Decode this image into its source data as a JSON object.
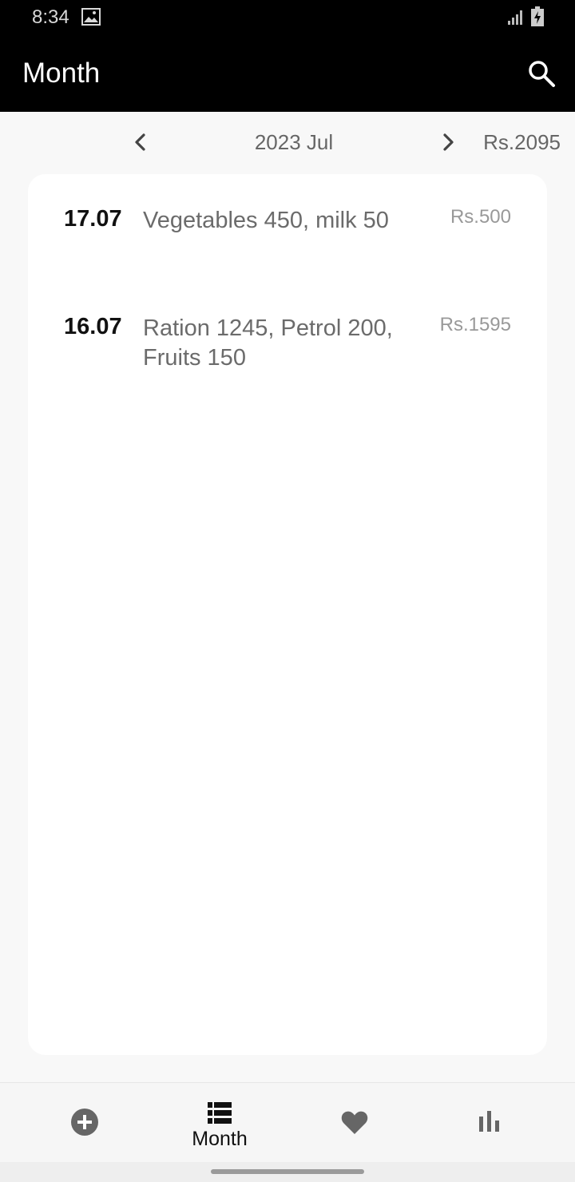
{
  "status_bar": {
    "time": "8:34"
  },
  "app_bar": {
    "title": "Month"
  },
  "month_nav": {
    "label": "2023 Jul",
    "total": "Rs.2095"
  },
  "entries": [
    {
      "date": "17.07",
      "description": "Vegetables 450, milk 50",
      "amount": "Rs.500"
    },
    {
      "date": "16.07",
      "description": "Ration 1245, Petrol 200, Fruits 150",
      "amount": "Rs.1595"
    }
  ],
  "bottom_nav": {
    "items": [
      {
        "icon": "add-circle-icon",
        "label": ""
      },
      {
        "icon": "list-icon",
        "label": "Month",
        "active": true
      },
      {
        "icon": "heart-icon",
        "label": ""
      },
      {
        "icon": "bar-chart-icon",
        "label": ""
      }
    ]
  }
}
